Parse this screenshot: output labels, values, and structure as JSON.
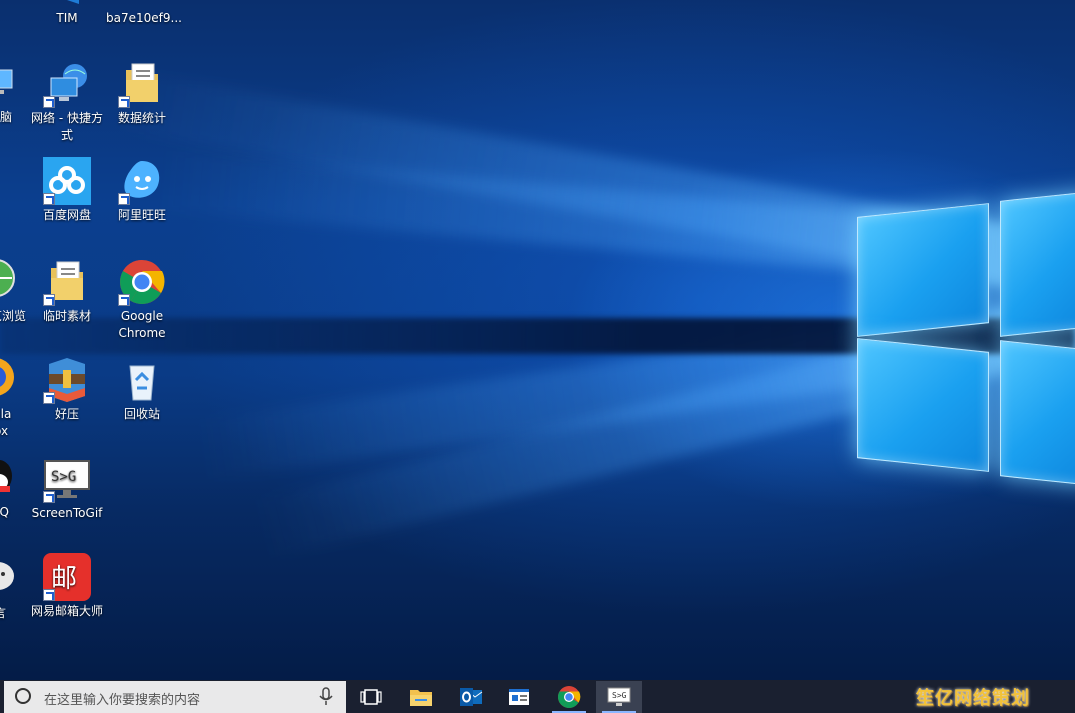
{
  "desktop": {
    "icons": [
      {
        "label": "TIM"
      },
      {
        "label": "ba7e10ef9..."
      },
      {
        "label": "网络 - 快捷方式"
      },
      {
        "label": "数据统计"
      },
      {
        "label": "百度网盘"
      },
      {
        "label": "阿里旺旺"
      },
      {
        "label": "临时素材"
      },
      {
        "label": "Google Chrome"
      },
      {
        "label": "好压"
      },
      {
        "label": "回收站"
      },
      {
        "label": "ScreenToGif"
      },
      {
        "label": "网易邮箱大师"
      }
    ],
    "partial_left_icons": [
      {
        "label": "脑"
      },
      {
        "label": "览浏览"
      },
      {
        "label": "illa ox"
      },
      {
        "label": "QQ"
      },
      {
        "label": "言"
      }
    ]
  },
  "taskbar": {
    "search_placeholder": "在这里输入你要搜索的内容",
    "buttons": [
      {
        "name": "task-view",
        "icon": "task-view-icon"
      },
      {
        "name": "file-explorer",
        "icon": "folder-icon"
      },
      {
        "name": "outlook",
        "icon": "outlook-icon"
      },
      {
        "name": "news",
        "icon": "window-app-icon"
      },
      {
        "name": "chrome",
        "icon": "chrome-icon"
      },
      {
        "name": "screentogif",
        "icon": "monitor-icon"
      }
    ]
  },
  "watermark": {
    "text": "笙亿网络策划"
  },
  "colors": {
    "accent": "#1aa0f0",
    "taskbar": "#1a2030",
    "search_box": "#e9e9ea"
  }
}
